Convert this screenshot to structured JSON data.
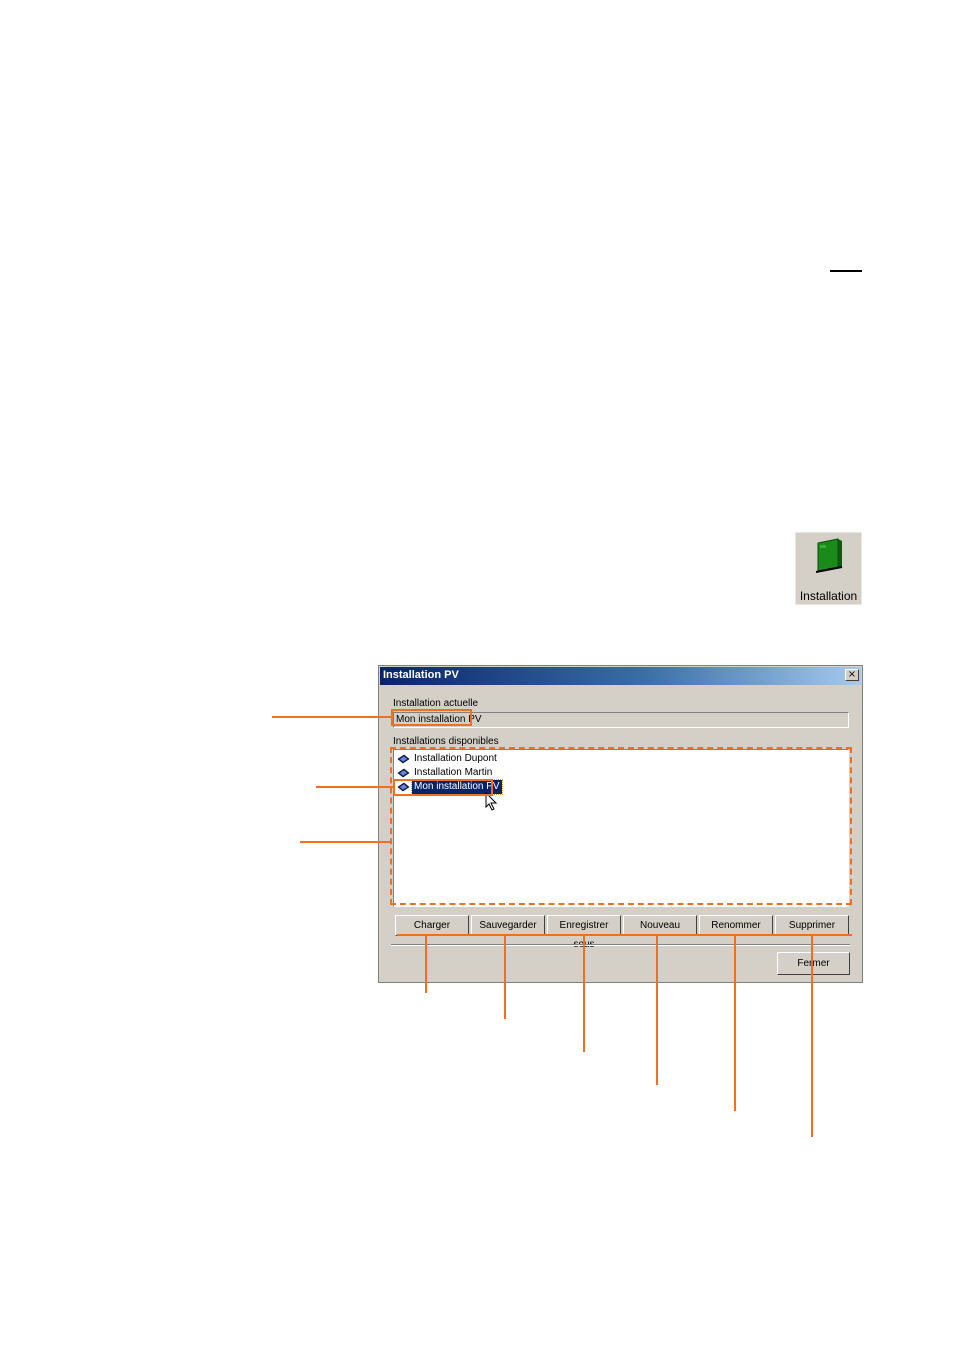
{
  "toolbar_icon": {
    "label": "Installation",
    "icon": "green-folder-icon"
  },
  "dialog": {
    "title": "Installation PV",
    "close_glyph": "×",
    "current_label": "Installation actuelle",
    "current_value": "Mon installation PV",
    "available_label": "Installations disponibles",
    "installations": [
      {
        "label": "Installation Dupont",
        "selected": false
      },
      {
        "label": "Installation Martin",
        "selected": false
      },
      {
        "label": "Mon installation PV",
        "selected": true
      }
    ],
    "buttons": [
      "Charger",
      "Sauvegarder",
      "Enregistrer sous",
      "Nouveau",
      "Renommer",
      "Supprimer"
    ],
    "close_button": "Fermer"
  },
  "colors": {
    "annotation": "#f07020",
    "dialog_bg": "#d4d0c8",
    "title_start": "#0a246a",
    "title_end": "#a6caf0",
    "selection": "#0a246a"
  }
}
